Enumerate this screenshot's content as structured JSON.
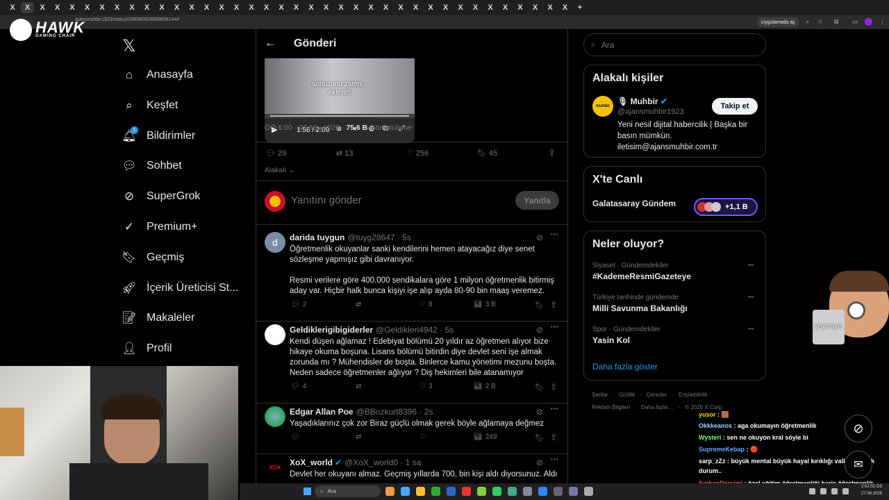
{
  "browser": {
    "tab_glyph": "X",
    "tab_count": 38,
    "new_tab": "+",
    "url": "ajansmuhbir1923/status/2092809336896561444",
    "app_chip": "Uygulamada aç"
  },
  "overlay": {
    "logo_name": "HAWK",
    "logo_sub": "GAMING CHAIR",
    "sticker_text": "yeymiye"
  },
  "nav": {
    "logo": "𝕏",
    "notification_count": "1",
    "items": [
      {
        "label": "Anasayfa",
        "icon": "home-icon"
      },
      {
        "label": "Keşfet",
        "icon": "search-icon"
      },
      {
        "label": "Bildirimler",
        "icon": "bell-icon"
      },
      {
        "label": "Sohbet",
        "icon": "chat-icon"
      },
      {
        "label": "SuperGrok",
        "icon": "grok-icon"
      },
      {
        "label": "Premium+",
        "icon": "premium-icon"
      },
      {
        "label": "Geçmiş",
        "icon": "bookmark-icon"
      },
      {
        "label": "İçerik Üreticisi St...",
        "icon": "rocket-icon"
      },
      {
        "label": "Makaleler",
        "icon": "article-icon"
      },
      {
        "label": "Profil",
        "icon": "person-icon"
      }
    ]
  },
  "post": {
    "header_title": "Gönderi",
    "video_caption_line1": "sonucunu zaten...",
    "video_caption_line2": "eklerim",
    "video_time": "1:58 / 2:09",
    "meta_time": "ÖÖ 6:00 · 27 Ağu 2026 · ",
    "views_count": "75,6 B",
    "views_label": " Görüntüleme",
    "replies": "29",
    "reposts": "13",
    "likes": "256",
    "bookmarks": "45",
    "sort_label": "Alakalı",
    "reply_placeholder": "Yanıtını gönder",
    "reply_button": "Yanıtla"
  },
  "replies": [
    {
      "avatar_letter": "d",
      "name": "darida tuygun",
      "handle": "@tuyg28647 · 5s",
      "text": "Öğretmenlik okuyanlar sanki kendilerini hemen atayacağız diye senet sözleşme yapmışız gibi davranıyor.\n\nResmi verilere göre 400.000 sendikalara göre 1 milyon öğretmenlik bitirmiş aday var. Hiçbir halk bunca kişiyi işe alıp ayda 80-90 bin maaş veremez.",
      "replies": "2",
      "reposts": "",
      "likes": "8",
      "views": "3 B"
    },
    {
      "avatar_letter": "",
      "name": "Geldiklerigibigiderler",
      "handle": "@Geldikleri4942 · 5s",
      "text": "Kendi düşen ağlamaz ! Edebiyat bölümü 20 yıldır az öğretmen alıyor bize hikaye okuma boşuna. Lisans bölümü bitirdin diye devlet seni işe almak zorunda mı ? Mühendisler de boşta. Binlerce kamu yönetimi mezunu boşta. Neden sadece öğretmenler ağlıyor ? Diş hekimleri bile atanamıyor",
      "replies": "4",
      "reposts": "",
      "likes": "3",
      "views": "2 B"
    },
    {
      "avatar_letter": "",
      "name": "Edgar Allan Poe",
      "handle": "@BBozkurt8396 · 2s",
      "text": "Yaşadıklarınız çok zor Biraz güçlü olmak gerek  böyle ağlamaya değmez",
      "replies": "",
      "reposts": "",
      "likes": "",
      "views": "249"
    },
    {
      "avatar_letter": "XOX",
      "name": "XoX_world",
      "handle": "@XoX_world0 · 1 sa",
      "text": "Devlet her okuyanı almaz. Geçmiş yıllarda 700, bin kişi aldı diyorsunuz. Aldı",
      "replies": "",
      "reposts": "",
      "likes": "",
      "views": ""
    }
  ],
  "right": {
    "search_placeholder": "Ara",
    "people_title": "Alakalı kişiler",
    "person_avatar": "muhbir",
    "person_name": "Muhbir",
    "person_handle": "@ajansmuhbir1923",
    "person_bio": "Yeni nesil dijital habercilik | Başka bir basın mümkün. iletisim@ajansmuhbir.com.tr",
    "follow_label": "Takip et",
    "live_title": "X'te Canlı",
    "live_item": "Galatasaray Gündem",
    "live_count": "+1,1 B",
    "trends_title": "Neler oluyor?",
    "trends": [
      {
        "context": "Siyaset · Gündemdekiler",
        "title": "#KademeResmiGazeteye"
      },
      {
        "context": "Türkiye tarihinde gündemde",
        "title": "Milli Savunma Bakanlığı"
      },
      {
        "context": "Spor · Gündemdekiler",
        "title": "Yasin Kol"
      }
    ],
    "show_more": "Daha fazla göster",
    "footer_1": "Şartlar   ·   Gizlilik   ·   Çerezler   ·   Erişilebilirlik",
    "footer_2": "Reklam Bilgileri   ·   Daha fazla ...   ·   © 2026 X Corp."
  },
  "chat": [
    {
      "user": "yusor",
      "color": "#ffd700",
      "msg": " : 🟫"
    },
    {
      "user": "Okkkeanos",
      "color": "#9fd0ff",
      "msg": " : aga okumayın öğretmenlik"
    },
    {
      "user": "Wysteri",
      "color": "#7cff7c",
      "msg": " : sen ne okuyon kral söyle bi"
    },
    {
      "user": "SupremeKebap",
      "color": "#6aa8ff",
      "msg": " : 🔴"
    },
    {
      "user": "sarp_zZz",
      "color": "#ffffff",
      "msg": " : büyük mental büyük hayal kırıklığı valla bombok durum.."
    },
    {
      "user": "SerkanDersimi",
      "color": "#ff5a5a",
      "msg": " : özel eğitim öğretmenliği hariç öğretmenlik çok kötü durumda"
    }
  ],
  "taskbar": {
    "search": "Ara",
    "clock_time": "2:52:02 ÖS",
    "clock_date": "27.08.2026"
  }
}
